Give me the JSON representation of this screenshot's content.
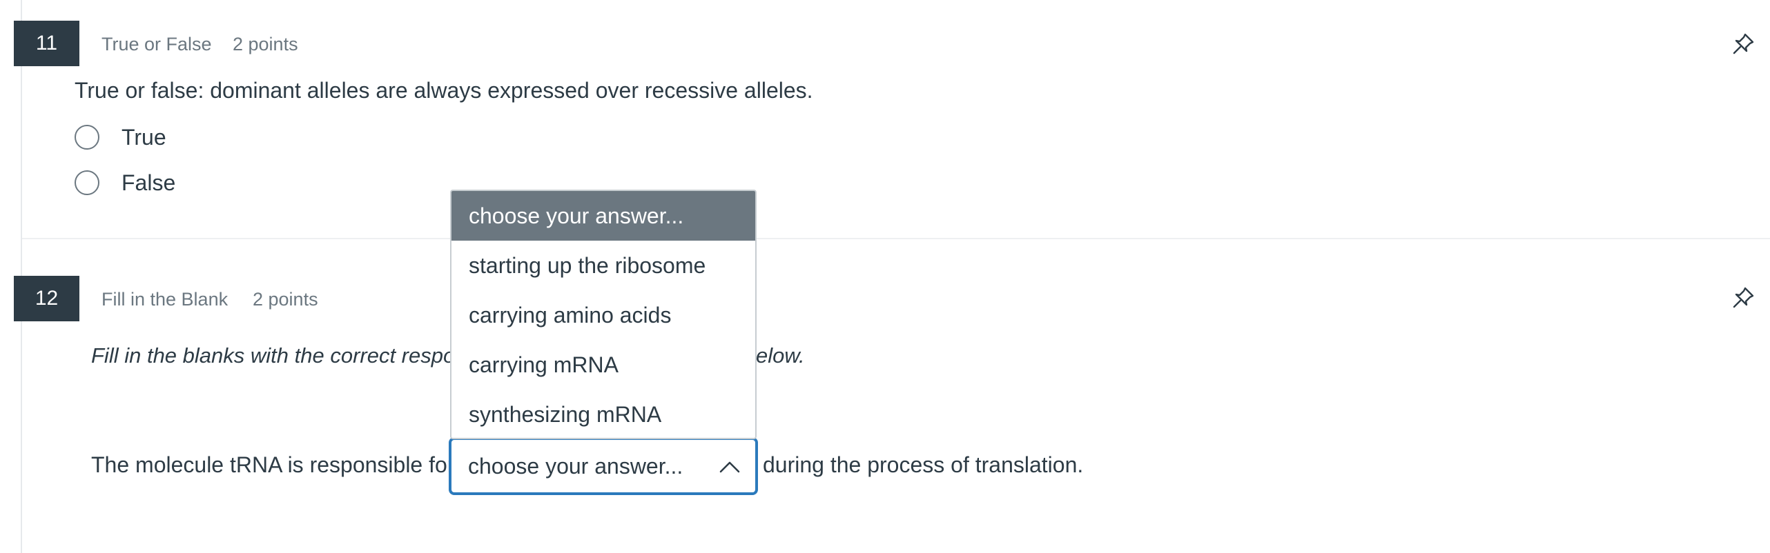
{
  "questions": [
    {
      "number": "11",
      "type": "True or False",
      "points": "2 points",
      "text": "True or false: dominant alleles are always expressed over recessive alleles.",
      "options": [
        "True",
        "False"
      ]
    },
    {
      "number": "12",
      "type": "Fill in the Blank",
      "points": "2 points",
      "instructions_start": "Fill in the blanks with the correct respons",
      "instructions_end": "elow.",
      "sentence_before": "The molecule tRNA is responsible for",
      "sentence_after": "during the process of translation.",
      "select": {
        "value": "choose your answer...",
        "expanded": true,
        "options": [
          "choose your answer...",
          "starting up the ribosome",
          "carrying amino acids",
          "carrying mRNA",
          "synthesizing mRNA"
        ],
        "highlighted_option": "choose your answer..."
      }
    }
  ],
  "icons": {
    "pin": "pin-icon",
    "radio": "radio-circle",
    "chevron": "chevron-up-icon"
  },
  "colors": {
    "number_badge_bg": "#2d3b45",
    "text": "#2d3b45",
    "muted": "#6b7780",
    "focus_border": "#2b7abc",
    "highlight_bg": "#6b7780"
  }
}
